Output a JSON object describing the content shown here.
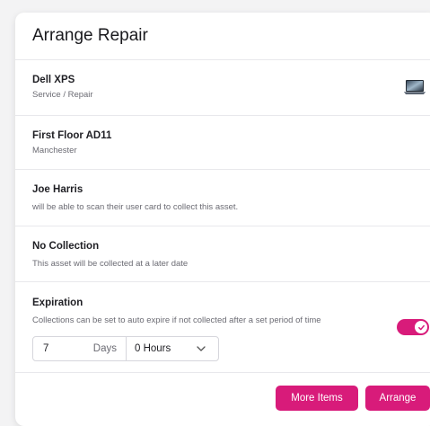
{
  "dialog": {
    "title": "Arrange Repair"
  },
  "asset": {
    "name": "Dell XPS",
    "type": "Service / Repair",
    "icon": "laptop-icon"
  },
  "location": {
    "name": "First Floor AD11",
    "city": "Manchester"
  },
  "collector": {
    "name": "Joe Harris",
    "description": "will be able to scan their user card to collect this asset."
  },
  "collection": {
    "name": "No Collection",
    "description": "This asset will be collected at a later date"
  },
  "expiration": {
    "title": "Expiration",
    "description": "Collections can be set to auto expire if not collected after a set period of time",
    "enabled": true,
    "days_value": "7",
    "days_unit": "Days",
    "hours_selected": "0 Hours"
  },
  "actions": {
    "more_items_label": "More Items",
    "arrange_label": "Arrange"
  },
  "colors": {
    "accent": "#d81b7a"
  }
}
